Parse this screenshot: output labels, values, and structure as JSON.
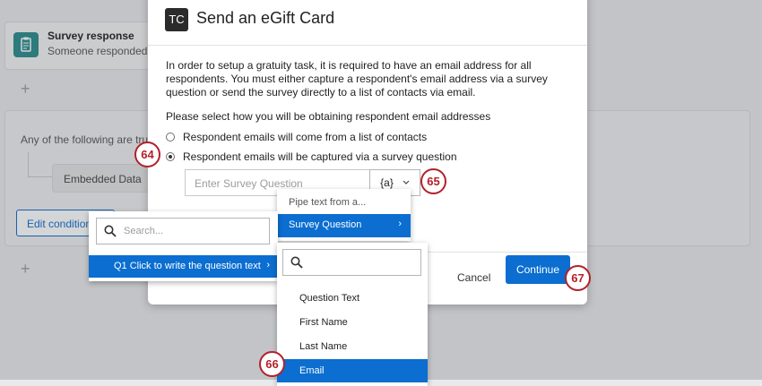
{
  "background": {
    "survey_response_title": "Survey response",
    "survey_response_subtitle": "Someone responded",
    "condition_text": "Any of the following are tru",
    "embedded_data": "Embedded Data",
    "edit_conditions": "Edit condition"
  },
  "modal": {
    "logo": "TC",
    "title": "Send an eGift Card",
    "description": "In order to setup a gratuity task, it is required to have an email address for all respondents. You must either capture a respondent's email address via a survey question or send the survey directly to a list of contacts via email.",
    "prompt": "Please select how you will be obtaining respondent email addresses",
    "options": [
      {
        "label": "Respondent emails will come from a list of contacts",
        "selected": false
      },
      {
        "label": "Respondent emails will be captured via a survey question",
        "selected": true
      }
    ],
    "survey_question_placeholder": "Enter Survey Question",
    "pipe_button": "{a}",
    "cancel": "Cancel",
    "continue": "Continue"
  },
  "pipe_menu": {
    "header": "Pipe text from a...",
    "survey_question": "Survey Question"
  },
  "question_menu": {
    "search_placeholder": "Search...",
    "item": "Q1 Click to write the question text"
  },
  "field_menu": {
    "items": [
      "Question Text",
      "First Name",
      "Last Name",
      "Email"
    ]
  },
  "badges": [
    "64",
    "65",
    "66",
    "67"
  ],
  "colors": {
    "accent": "#0b6ed0",
    "badge": "#b3202a"
  }
}
